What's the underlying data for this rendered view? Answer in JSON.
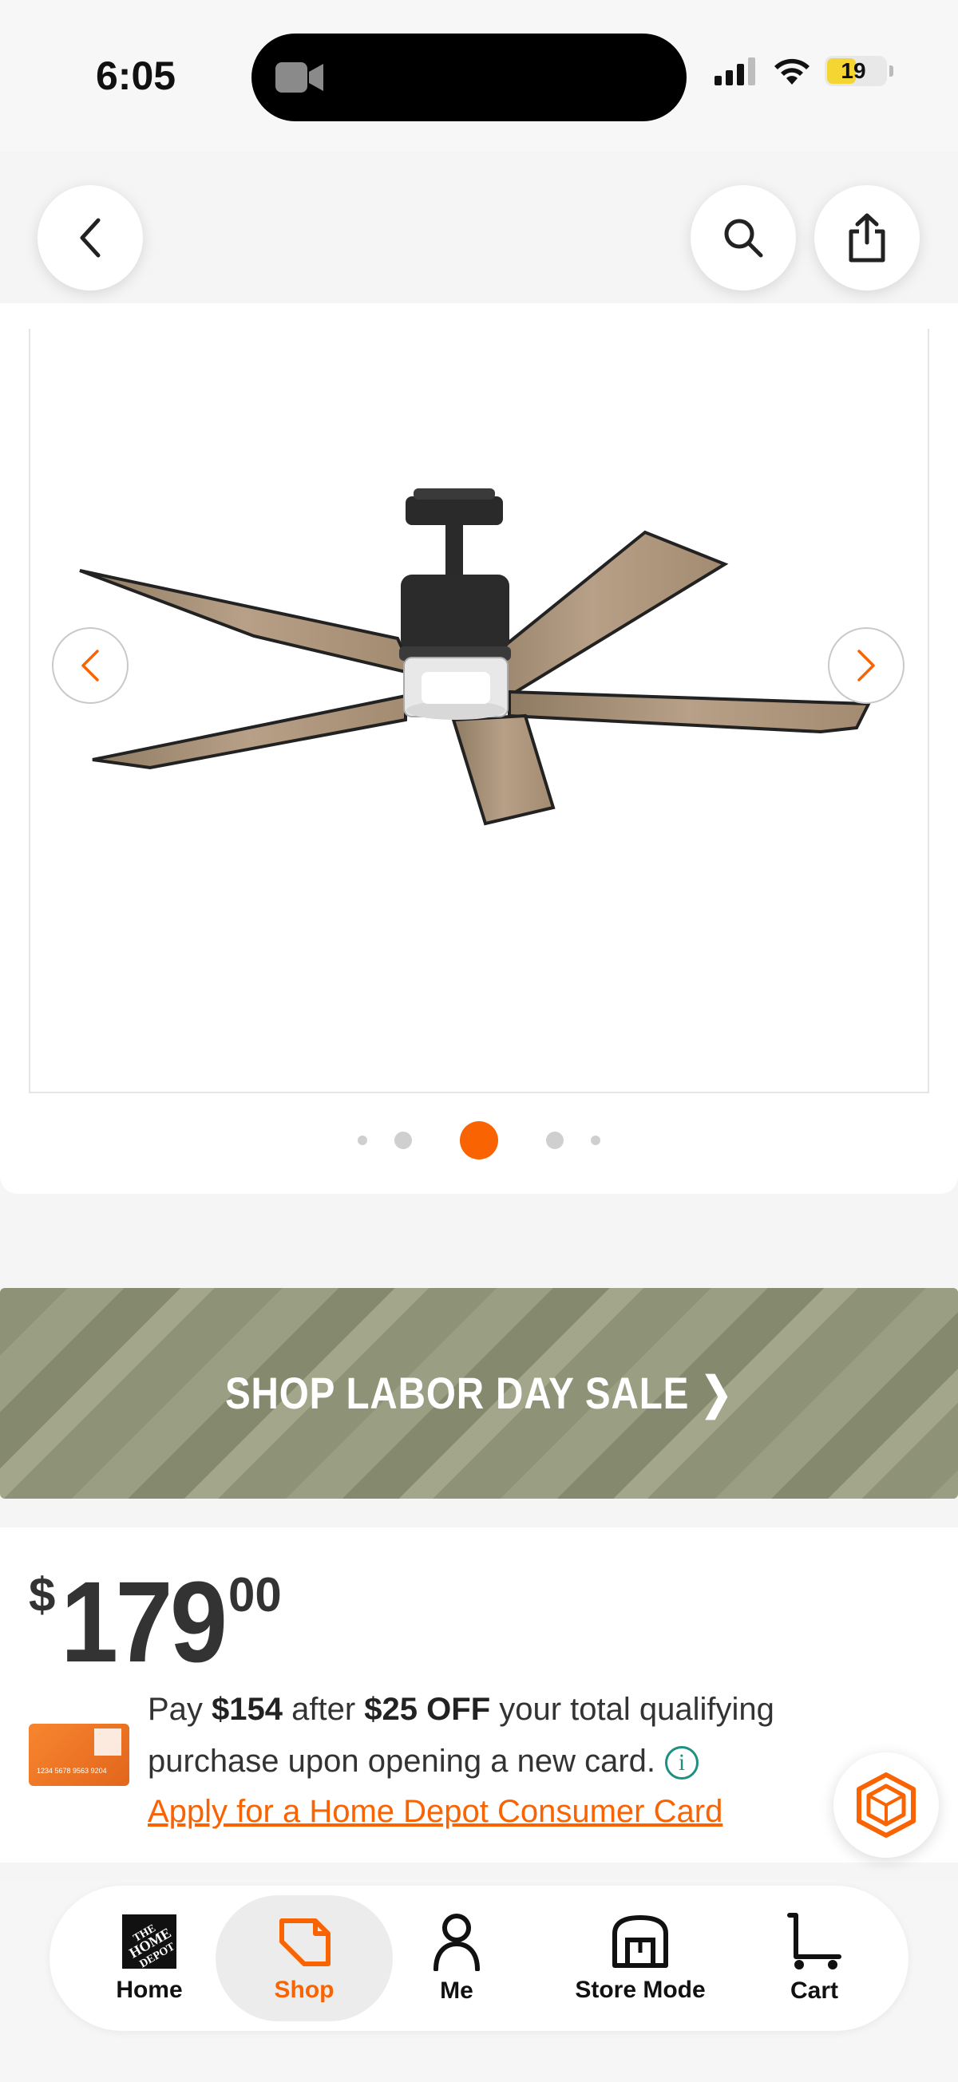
{
  "status_bar": {
    "time": "6:05",
    "battery": "19"
  },
  "nav": {
    "back_icon": "chevron-left-icon",
    "search_icon": "search-icon",
    "share_icon": "share-icon"
  },
  "gallery": {
    "image_alt": "five-blade ceiling fan with light kit",
    "dots": 5,
    "active_index": 2
  },
  "promo": {
    "label": "SHOP LABOR DAY SALE ❯"
  },
  "price": {
    "dollar_sign": "$",
    "whole": "179",
    "cents": "00"
  },
  "offer": {
    "pay_prefix": "Pay ",
    "pay_amount": "$154",
    "after": " after ",
    "discount": "$25 OFF",
    "suffix": " your total qualifying purchase upon opening a new card.",
    "info_glyph": "i",
    "link_text": "Apply for a Home Depot Consumer Card",
    "card_number": "1234 5678 9563 9204"
  },
  "tabs": [
    {
      "label": "Home"
    },
    {
      "label": "Shop"
    },
    {
      "label": "Me"
    },
    {
      "label": "Store Mode"
    },
    {
      "label": "Cart"
    }
  ],
  "colors": {
    "accent": "#f96302",
    "info_teal": "#1f8f80"
  }
}
